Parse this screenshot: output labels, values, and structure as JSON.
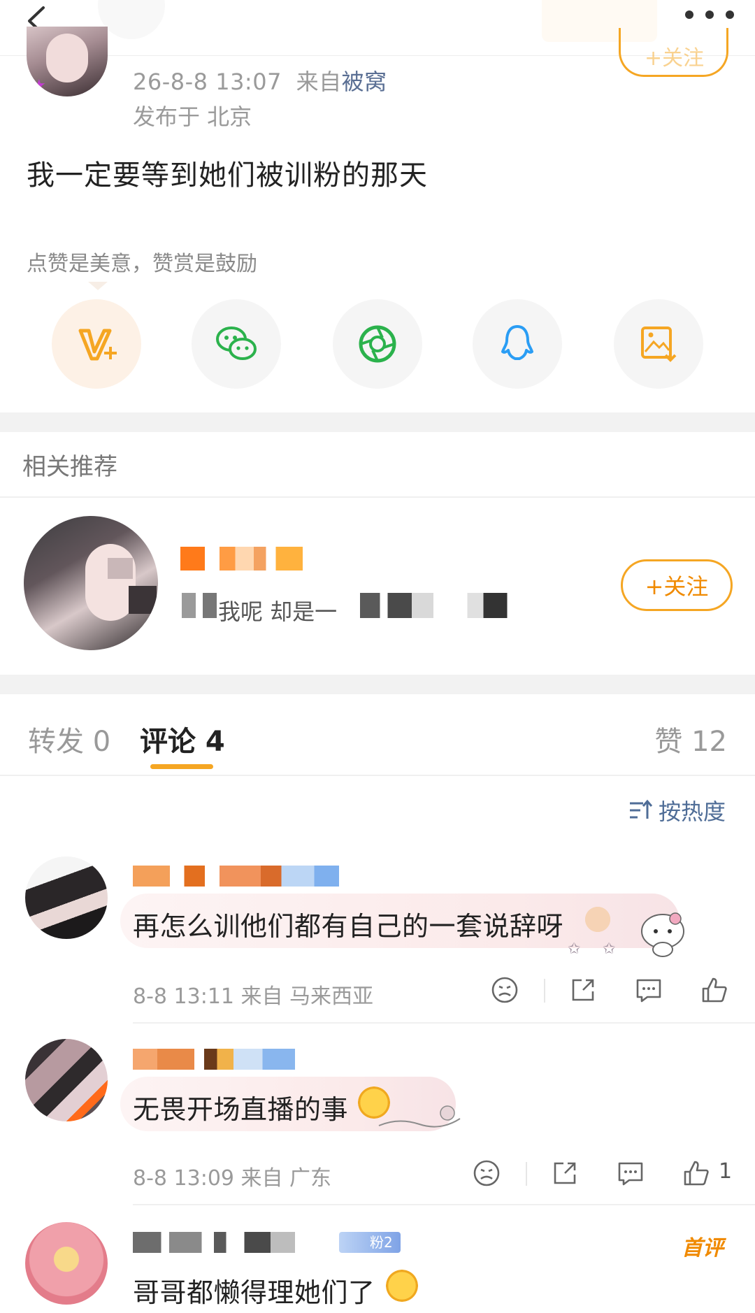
{
  "post": {
    "time": "26-8-8 13:07",
    "source_prefix": "来自",
    "source": "被窝",
    "location": "发布于 北京",
    "text": "我一定要等到她们被训粉的那天",
    "follow_label": "+关注"
  },
  "reward": {
    "tip": "点赞是美意，赞赏是鼓励"
  },
  "share": [
    {
      "name": "vip-reward",
      "icon": "v-plus-icon"
    },
    {
      "name": "wechat",
      "icon": "wechat-icon"
    },
    {
      "name": "moments",
      "icon": "moments-shutter-icon"
    },
    {
      "name": "qq",
      "icon": "qq-penguin-icon"
    },
    {
      "name": "save-image",
      "icon": "save-image-icon"
    }
  ],
  "related": {
    "title": "相关推荐",
    "bio_visible": "我呢 却是一",
    "follow_label": "+关注"
  },
  "tabs": {
    "forward": "转发 0",
    "comment": "评论 4",
    "like": "赞 12"
  },
  "sort": {
    "label": "按热度"
  },
  "comments": [
    {
      "text": "再怎么训他们都有自己的一套说辞呀",
      "meta": "8-8 13:11  来自 马来西亚",
      "likes": ""
    },
    {
      "text": "无畏开场直播的事",
      "meta": "8-8 13:09  来自 广东",
      "likes": "1"
    },
    {
      "text": "哥哥都懒得理她们了",
      "badge": "首评",
      "fan_badge": "粉2"
    }
  ],
  "colors": {
    "accent": "#f5a623",
    "link": "#5a6f94",
    "sort": "#4f6d97"
  }
}
